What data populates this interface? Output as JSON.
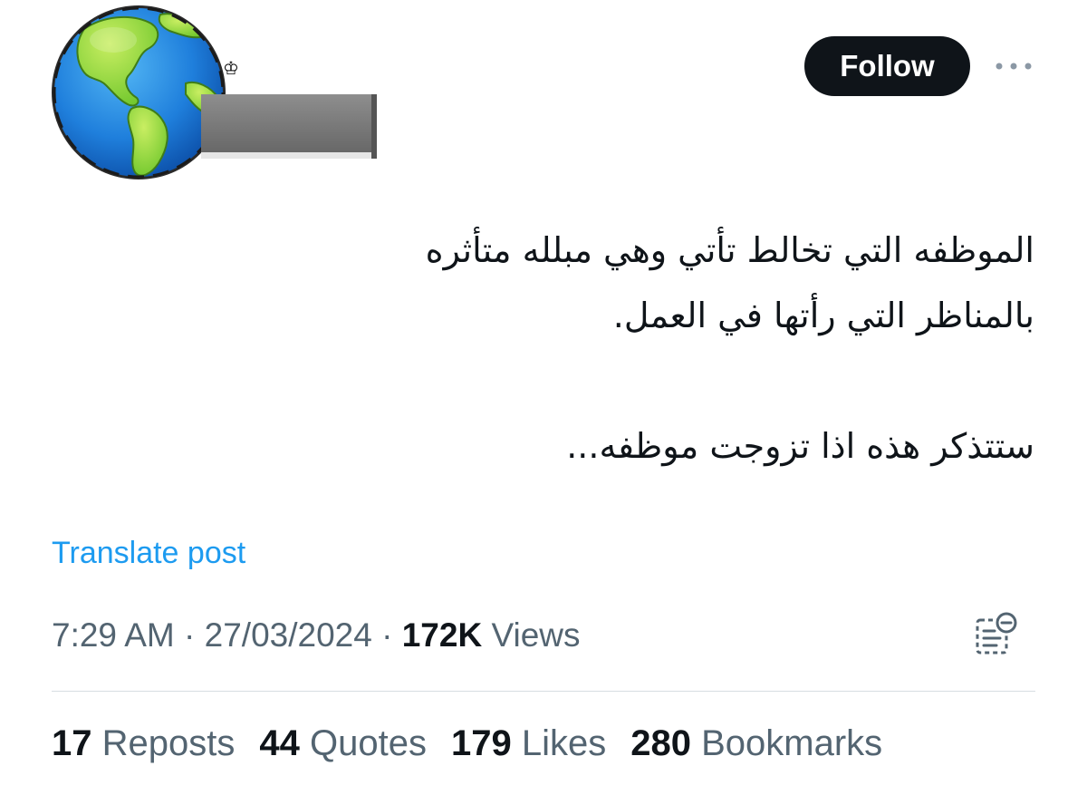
{
  "author": {
    "avatar_icon": "globe-icon",
    "name_redacted": true,
    "small_glyph": "♔"
  },
  "header": {
    "follow_label": "Follow",
    "more_icon": "more-horizontal-icon"
  },
  "post": {
    "lines": [
      "الموظفه التي تخالط تأتي وهي مبلله متأثره",
      "بالمناظر التي رأتها في العمل.",
      "ستتذكر هذه اذا تزوجت موظفه..."
    ],
    "translate_label": "Translate post"
  },
  "meta": {
    "time": "7:29 AM",
    "separator": "·",
    "date": "27/03/2024",
    "views_count": "172K",
    "views_label": "Views",
    "analytics_icon": "post-analytics-icon"
  },
  "stats": {
    "reposts": {
      "count": "17",
      "label": "Reposts"
    },
    "quotes": {
      "count": "44",
      "label": "Quotes"
    },
    "likes": {
      "count": "179",
      "label": "Likes"
    },
    "bookmarks": {
      "count": "280",
      "label": "Bookmarks"
    }
  },
  "colors": {
    "text_primary": "#0f1419",
    "text_secondary": "#536471",
    "link": "#1d9bf0",
    "follow_bg": "#0f1419",
    "follow_text": "#ffffff",
    "divider": "#d7dde2"
  }
}
